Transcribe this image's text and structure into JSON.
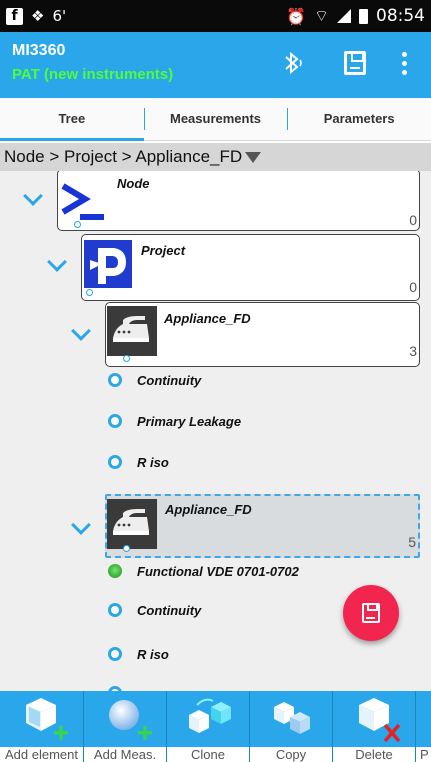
{
  "status_bar": {
    "notification_badge": "6'",
    "time": "08:54",
    "icons": [
      "facebook-icon",
      "dropbox-icon",
      "alarm-icon",
      "wifi-icon",
      "signal-icon",
      "battery-icon"
    ]
  },
  "app_bar": {
    "title": "MI3360",
    "subtitle": "PAT (new instruments)",
    "subtitle_color": "#4cff3a",
    "background": "#2aa6ea",
    "actions": [
      "bluetooth-icon",
      "save-icon",
      "more-vert-icon"
    ]
  },
  "tabs": [
    {
      "label": "Tree",
      "active": true
    },
    {
      "label": "Measurements",
      "active": false
    },
    {
      "label": "Parameters",
      "active": false
    }
  ],
  "breadcrumb": {
    "path": "Node > Project > Appliance_FD"
  },
  "tree": {
    "node": {
      "label": "Node",
      "count": "0"
    },
    "project": {
      "label": "Project",
      "count": "0"
    },
    "appliance1": {
      "label": "Appliance_FD",
      "count": "3"
    },
    "appliance1_measurements": [
      {
        "label": "Continuity",
        "status": "not-done"
      },
      {
        "label": "Primary Leakage",
        "status": "not-done"
      },
      {
        "label": "R iso",
        "status": "not-done"
      }
    ],
    "appliance2": {
      "label": "Appliance_FD",
      "count": "5",
      "selected": true
    },
    "appliance2_measurements": [
      {
        "label": "Functional VDE 0701-0702",
        "status": "passed"
      },
      {
        "label": "Continuity",
        "status": "not-done"
      },
      {
        "label": "R iso",
        "status": "not-done"
      }
    ]
  },
  "fab": {
    "icon": "save-icon",
    "color": "#f2254f"
  },
  "toolbar": {
    "items": [
      {
        "label": "Add element",
        "icon": "add-element-icon"
      },
      {
        "label": "Add Meas.",
        "icon": "add-measurement-icon"
      },
      {
        "label": "Clone",
        "icon": "clone-icon"
      },
      {
        "label": "Copy",
        "icon": "copy-icon"
      },
      {
        "label": "Delete",
        "icon": "delete-icon"
      },
      {
        "label": "P",
        "icon": "paste-icon"
      }
    ]
  }
}
